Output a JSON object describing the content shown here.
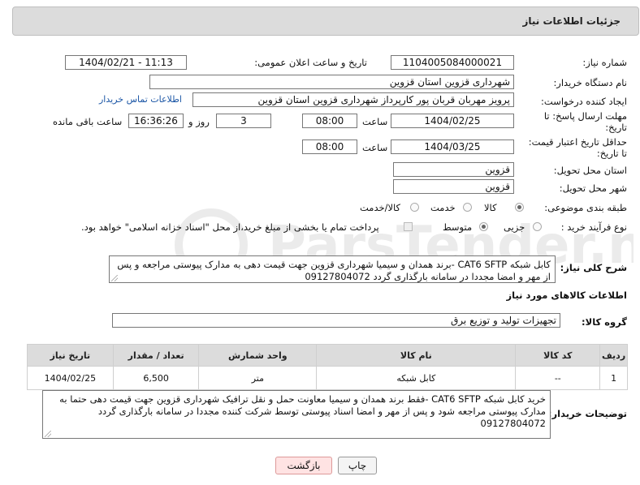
{
  "header": {
    "title": "جزئیات اطلاعات نیاز"
  },
  "form": {
    "need_number_label": "شماره نیاز:",
    "need_number": "1104005084000021",
    "announce_label": "تاریخ و ساعت اعلان عمومی:",
    "announce_value": "1404/02/21 - 11:13",
    "buyer_org_label": "نام دستگاه خریدار:",
    "buyer_org": "شهرداری قزوین استان قزوین",
    "requester_label": "ایجاد کننده درخواست:",
    "requester": "پرویز مهربان قربان پور کارپرداز شهرداری قزوین استان قزوین",
    "contact_link": "اطلاعات تماس خریدار",
    "deadline_label_1": "مهلت ارسال پاسخ: تا",
    "deadline_label_2": "تاریخ:",
    "deadline_date": "1404/02/25",
    "time_label": "ساعت",
    "deadline_time": "08:00",
    "days_value": "3",
    "days_label": "روز و",
    "remaining_time": "16:36:26",
    "remaining_label": "ساعت باقی مانده",
    "validity_label_1": "حداقل تاریخ اعتبار قیمت:",
    "validity_label_2": "تا تاریخ:",
    "validity_date": "1404/03/25",
    "validity_time": "08:00",
    "province_label": "استان محل تحویل:",
    "province": "قزوین",
    "city_label": "شهر محل تحویل:",
    "city": "قزوین",
    "category_label": "طبقه بندی موضوعی:",
    "category_options": [
      "کالا",
      "خدمت",
      "کالا/خدمت"
    ],
    "category_selected": "کالا",
    "process_label": "نوع فرآیند خرید :",
    "process_options": [
      "جزیی",
      "متوسط"
    ],
    "process_selected": "متوسط",
    "payment_note": "پرداخت تمام یا بخشی از مبلغ خرید،از محل \"اسناد خزانه اسلامی\" خواهد بود."
  },
  "description": {
    "label": "شرح کلی نیاز:",
    "text": "کابل شبکه CAT6 SFTP -برند همدان و سیمیا شهرداری قزوین جهت قیمت دهی به مدارک پیوستی مراجعه و پس از مهر و امضا مجددا در سامانه بارگذاری گردد 09127804072"
  },
  "goods": {
    "section_title": "اطلاعات کالاهای مورد نیاز",
    "group_label": "گروه کالا:",
    "group_value": "تجهیزات تولید و توزیع برق",
    "columns": [
      "ردیف",
      "کد کالا",
      "نام کالا",
      "واحد شمارش",
      "تعداد / مقدار",
      "تاریخ نیاز"
    ],
    "rows": [
      {
        "row": "1",
        "code": "--",
        "name": "کابل شبکه",
        "unit": "متر",
        "qty": "6,500",
        "date": "1404/02/25"
      }
    ]
  },
  "buyer_notes": {
    "label": "توضیحات خریدار:",
    "text": "خرید کابل شبکه CAT6 SFTP -فقط برند همدان و سیمیا معاونت حمل و نقل ترافیک شهرداری قزوین جهت قیمت دهی حتما به مدارک پیوستی مراجعه شود و پس از مهر و امضا اسناد پیوستی توسط شرکت کننده مجددا در سامانه بارگذاری گردد 09127804072"
  },
  "buttons": {
    "print": "چاپ",
    "back": "بازگشت"
  },
  "watermark": {
    "text": "ParsTender.net"
  }
}
